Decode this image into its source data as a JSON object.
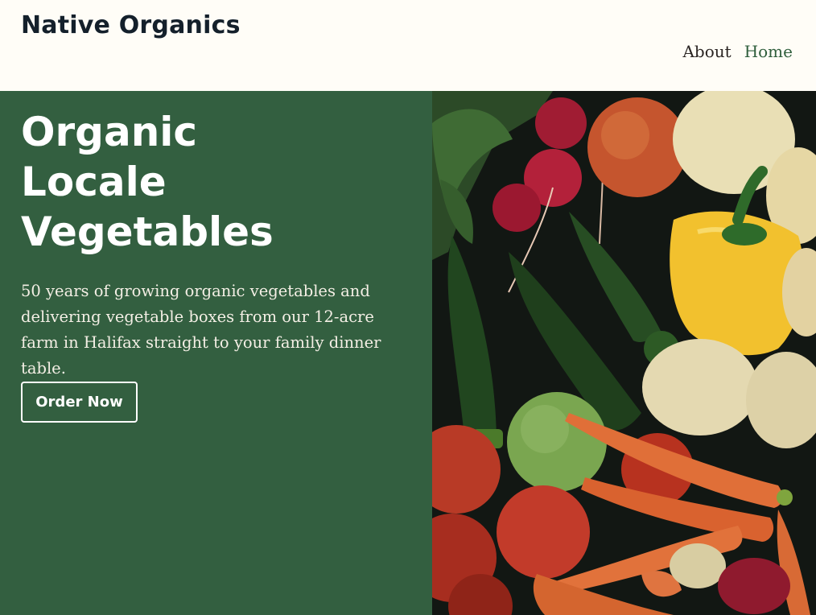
{
  "header": {
    "brand": "Native Organics",
    "nav": [
      {
        "label": "About",
        "active": false
      },
      {
        "label": "Home",
        "active": true
      }
    ]
  },
  "hero": {
    "title_lines": [
      "Organic",
      "Locale",
      "Vegetables"
    ],
    "description": "50 years of growing organic vegetables and delivering vegetable boxes from our 12-acre farm in Halifax straight to your family dinner table.",
    "cta_label": "Order Now",
    "image_alt": "Assorted fresh vegetables: radishes, zucchini, potatoes, yellow bell pepper, tomatoes and carrots"
  },
  "colors": {
    "page_bg": "#fffdf7",
    "brand_text": "#14202b",
    "nav_active": "#2f5e3c",
    "hero_green": "#335f40"
  }
}
